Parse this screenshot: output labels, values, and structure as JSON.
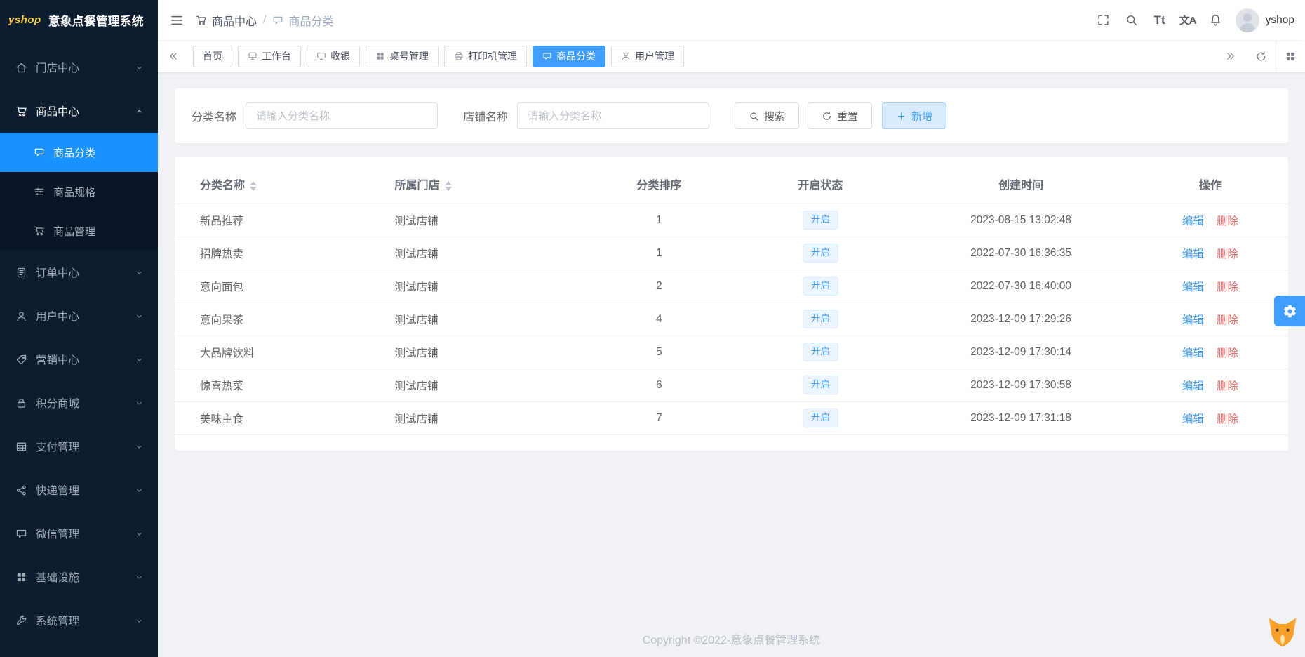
{
  "app": {
    "logo": "yshop",
    "title": "意象点餐管理系统"
  },
  "header": {
    "breadcrumb": [
      {
        "label": "商品中心",
        "icon": "cart"
      },
      {
        "label": "商品分类",
        "icon": "comment"
      }
    ],
    "separator": "/",
    "font_icon": "Tt",
    "translate_icon": "文A",
    "user": "yshop"
  },
  "sidebar": {
    "menu": [
      {
        "key": "store-center",
        "label": "门店中心",
        "icon": "home",
        "expanded": false
      },
      {
        "key": "product-center",
        "label": "商品中心",
        "icon": "cart",
        "expanded": true,
        "children": [
          {
            "key": "product-category",
            "label": "商品分类",
            "icon": "comment",
            "active": true
          },
          {
            "key": "product-spec",
            "label": "商品规格",
            "icon": "sliders",
            "active": false
          },
          {
            "key": "product-manage",
            "label": "商品管理",
            "icon": "cart",
            "active": false
          }
        ]
      },
      {
        "key": "order-center",
        "label": "订单中心",
        "icon": "order",
        "expanded": false
      },
      {
        "key": "user-center",
        "label": "用户中心",
        "icon": "user",
        "expanded": false
      },
      {
        "key": "marketing-center",
        "label": "营销中心",
        "icon": "tag",
        "expanded": false
      },
      {
        "key": "points-mall",
        "label": "积分商城",
        "icon": "lock",
        "expanded": false
      },
      {
        "key": "payment-manage",
        "label": "支付管理",
        "icon": "payment",
        "expanded": false
      },
      {
        "key": "express-manage",
        "label": "快递管理",
        "icon": "express",
        "expanded": false
      },
      {
        "key": "wechat-manage",
        "label": "微信管理",
        "icon": "comment",
        "expanded": false
      },
      {
        "key": "infrastructure",
        "label": "基础设施",
        "icon": "infra",
        "expanded": false
      },
      {
        "key": "system-manage",
        "label": "系统管理",
        "icon": "wrench",
        "expanded": false
      }
    ]
  },
  "tags": [
    {
      "key": "home",
      "label": "首页",
      "icon": null,
      "active": false
    },
    {
      "key": "workbench",
      "label": "工作台",
      "icon": "platform",
      "active": false
    },
    {
      "key": "cashier",
      "label": "收银",
      "icon": "monitor",
      "active": false
    },
    {
      "key": "table-manage",
      "label": "桌号管理",
      "icon": "grid",
      "active": false
    },
    {
      "key": "printer-manage",
      "label": "打印机管理",
      "icon": "printer",
      "active": false
    },
    {
      "key": "product-category",
      "label": "商品分类",
      "icon": "comment",
      "active": true
    },
    {
      "key": "user-manage",
      "label": "用户管理",
      "icon": "user",
      "active": false
    }
  ],
  "filters": {
    "fields": [
      {
        "label": "分类名称",
        "placeholder": "请输入分类名称",
        "value": ""
      },
      {
        "label": "店铺名称",
        "placeholder": "请输入分类名称",
        "value": ""
      }
    ],
    "search": "搜索",
    "reset": "重置",
    "add": "新增"
  },
  "table": {
    "columns": [
      {
        "label": "分类名称",
        "sortable": true
      },
      {
        "label": "所属门店",
        "sortable": true
      },
      {
        "label": "分类排序",
        "sortable": false
      },
      {
        "label": "开启状态",
        "sortable": false
      },
      {
        "label": "创建时间",
        "sortable": false
      },
      {
        "label": "操作",
        "sortable": false
      }
    ],
    "rows": [
      {
        "name": "新品推荐",
        "store": "测试店铺",
        "sort": "1",
        "status": "开启",
        "created": "2023-08-15 13:02:48"
      },
      {
        "name": "招牌热卖",
        "store": "测试店铺",
        "sort": "1",
        "status": "开启",
        "created": "2022-07-30 16:36:35"
      },
      {
        "name": "意向面包",
        "store": "测试店铺",
        "sort": "2",
        "status": "开启",
        "created": "2022-07-30 16:40:00"
      },
      {
        "name": "意向果茶",
        "store": "测试店铺",
        "sort": "4",
        "status": "开启",
        "created": "2023-12-09 17:29:26"
      },
      {
        "name": "大品牌饮料",
        "store": "测试店铺",
        "sort": "5",
        "status": "开启",
        "created": "2023-12-09 17:30:14"
      },
      {
        "name": "惊喜热菜",
        "store": "测试店铺",
        "sort": "6",
        "status": "开启",
        "created": "2023-12-09 17:30:58"
      },
      {
        "name": "美味主食",
        "store": "测试店铺",
        "sort": "7",
        "status": "开启",
        "created": "2023-12-09 17:31:18"
      }
    ],
    "actions": {
      "edit": "编辑",
      "delete": "删除"
    }
  },
  "footer": {
    "copyright": "Copyright ©2022-意象点餐管理系统"
  },
  "colors": {
    "primary": "#409eff",
    "active_menu": "#1890ff",
    "sidebar_bg": "#0c1d30",
    "danger": "#f56c6c",
    "status_badge_bg": "#ecf5ff"
  }
}
